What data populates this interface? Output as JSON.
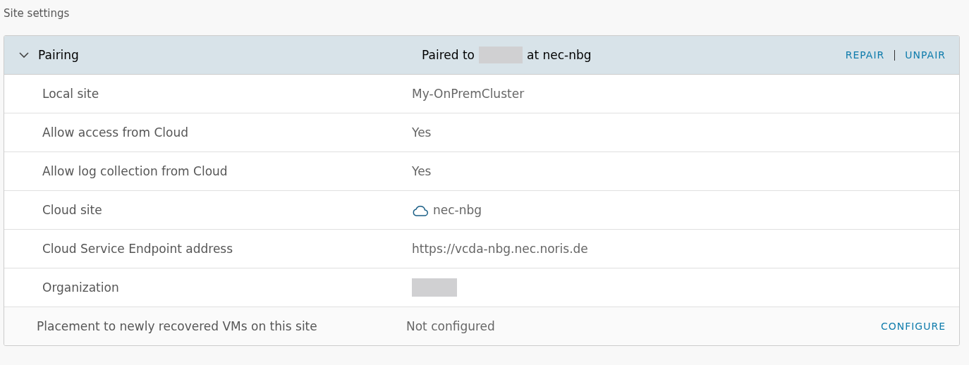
{
  "page_title": "Site settings",
  "pairing": {
    "title": "Pairing",
    "expanded": true,
    "status_prefix": "Paired to",
    "status_redacted": true,
    "status_suffix": "at nec-nbg",
    "actions": [
      "REPAIR",
      "UNPAIR"
    ],
    "rows": [
      {
        "label": "Local site",
        "kind": "text",
        "value": "My-OnPremCluster"
      },
      {
        "label": "Allow access from Cloud",
        "kind": "text",
        "value": "Yes"
      },
      {
        "label": "Allow log collection from Cloud",
        "kind": "text",
        "value": "Yes"
      },
      {
        "label": "Cloud site",
        "kind": "site",
        "value": "nec-nbg"
      },
      {
        "label": "Cloud Service Endpoint address",
        "kind": "text",
        "value": "https://vcda-nbg.nec.noris.de"
      },
      {
        "label": "Organization",
        "kind": "redacted"
      }
    ]
  },
  "placement": {
    "label": "Placement to newly recovered VMs on this site",
    "value": "Not configured",
    "action": "CONFIGURE"
  }
}
